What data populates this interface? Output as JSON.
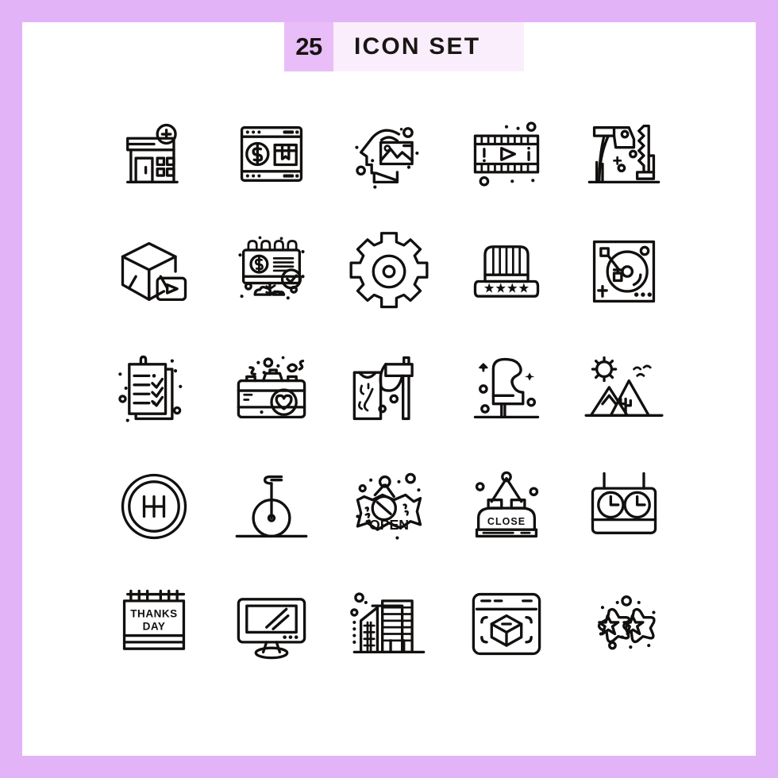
{
  "page": {
    "background_color": "#e3b3f7",
    "panel_color": "#ffffff",
    "stroke_color": "#12100f"
  },
  "header": {
    "count": "25",
    "title": "ICON SET",
    "badge_color": "#e9bdf7",
    "title_background_color": "#faeefc"
  },
  "grid": {
    "columns": 5,
    "rows": 5,
    "icons": [
      {
        "index": 1,
        "name": "pharmacy-store-icon",
        "label": "Pharmacy store with plus sign"
      },
      {
        "index": 2,
        "name": "online-shopping-icon",
        "label": "Browser window with dollar and product box"
      },
      {
        "index": 3,
        "name": "imagination-head-icon",
        "label": "Head with picture, creative mind"
      },
      {
        "index": 4,
        "name": "film-strip-play-icon",
        "label": "Film strip with play button"
      },
      {
        "index": 5,
        "name": "axe-and-saw-icon",
        "label": "Axe and saw carpentry tools"
      },
      {
        "index": 6,
        "name": "cube-video-icon",
        "label": "3D cube with video play"
      },
      {
        "index": 7,
        "name": "billboard-money-check-icon",
        "label": "Money billboard with check mark"
      },
      {
        "index": 8,
        "name": "gear-settings-icon",
        "label": "Gear settings cog"
      },
      {
        "index": 9,
        "name": "patriotic-hat-icon",
        "label": "Top hat with four stars"
      },
      {
        "index": 10,
        "name": "turntable-icon",
        "label": "DJ turntable vinyl player"
      },
      {
        "index": 11,
        "name": "checklist-document-icon",
        "label": "Checklist document with ticks"
      },
      {
        "index": 12,
        "name": "camera-heart-icon",
        "label": "Photo camera with heart"
      },
      {
        "index": 13,
        "name": "wood-log-axe-icon",
        "label": "Wood log with axe"
      },
      {
        "index": 14,
        "name": "grand-piano-icon",
        "label": "Grand piano"
      },
      {
        "index": 15,
        "name": "mountains-sun-icon",
        "label": "Mountains with sun, birds and cactus"
      },
      {
        "index": 16,
        "name": "gear-shift-icon",
        "label": "Gear shift transmission knob"
      },
      {
        "index": 17,
        "name": "unicycle-icon",
        "label": "Unicycle"
      },
      {
        "index": 18,
        "name": "open-sign-icon",
        "label": "OPEN hanging shop sign"
      },
      {
        "index": 19,
        "name": "close-sign-icon",
        "label": "CLOSE hanging shop sign"
      },
      {
        "index": 20,
        "name": "chess-clock-icon",
        "label": "Double clock board"
      },
      {
        "index": 21,
        "name": "thanks-day-calendar-icon",
        "label": "THANKS DAY calendar"
      },
      {
        "index": 22,
        "name": "desktop-monitor-icon",
        "label": "Desktop computer monitor"
      },
      {
        "index": 23,
        "name": "city-buildings-icon",
        "label": "City skyscraper buildings"
      },
      {
        "index": 24,
        "name": "ar-cube-browser-icon",
        "label": "Browser window with 3D cube scan"
      },
      {
        "index": 25,
        "name": "two-stars-icon",
        "label": "Two star cookies with sparkles"
      }
    ]
  },
  "icon_text": {
    "open_sign": "OPEN",
    "close_sign": "CLOSE",
    "calendar_line1": "THANKS",
    "calendar_line2": "DAY"
  }
}
